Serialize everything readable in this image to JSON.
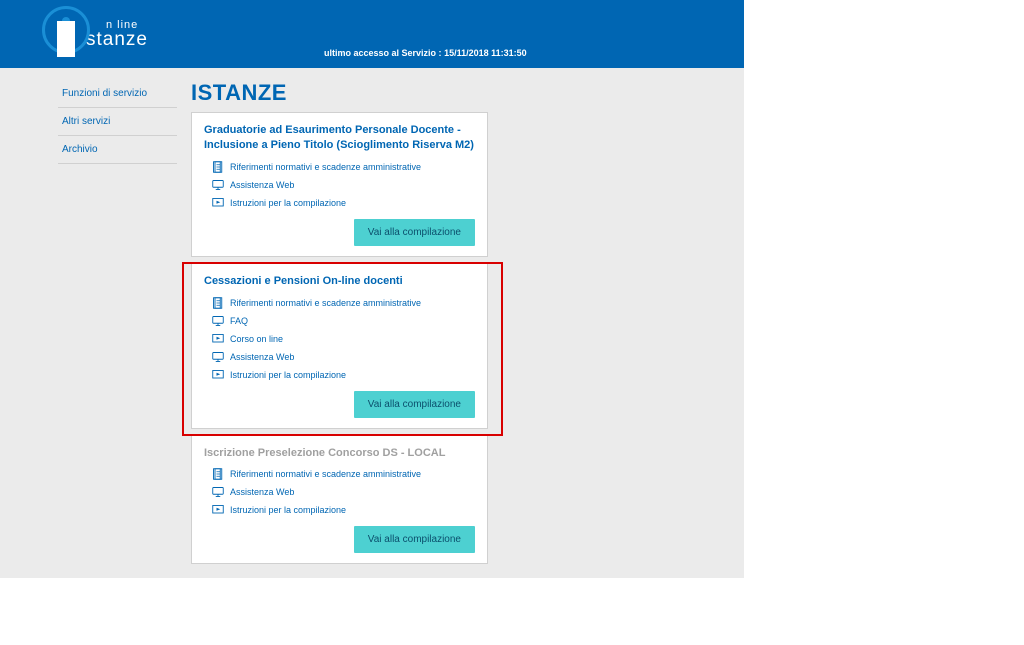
{
  "header": {
    "logo_line1": "n line",
    "logo_line2": "stanze",
    "last_access_label": "ultimo accesso al Servizio :",
    "last_access_value": "15/11/2018 11:31:50"
  },
  "sidebar": {
    "items": [
      {
        "label": "Funzioni di servizio"
      },
      {
        "label": "Altri servizi"
      },
      {
        "label": "Archivio"
      }
    ]
  },
  "main": {
    "title": "ISTANZE",
    "compile_button": "Vai alla compilazione",
    "cards": [
      {
        "title": "Graduatorie ad Esaurimento Personale Docente - Inclusione a Pieno Titolo (Scioglimento Riserva M2)",
        "highlight": false,
        "links": [
          {
            "icon": "doc",
            "label": "Riferimenti normativi e scadenze amministrative"
          },
          {
            "icon": "web",
            "label": "Assistenza Web"
          },
          {
            "icon": "play",
            "label": "Istruzioni per la compilazione"
          }
        ]
      },
      {
        "title": "Cessazioni e Pensioni On-line docenti",
        "highlight": true,
        "links": [
          {
            "icon": "doc",
            "label": "Riferimenti normativi e scadenze amministrative"
          },
          {
            "icon": "web",
            "label": "FAQ"
          },
          {
            "icon": "play",
            "label": "Corso on line"
          },
          {
            "icon": "web",
            "label": "Assistenza Web"
          },
          {
            "icon": "play",
            "label": "Istruzioni per la compilazione"
          }
        ]
      },
      {
        "title": "Iscrizione Preselezione Concorso DS - LOCAL",
        "highlight": false,
        "links": [
          {
            "icon": "doc",
            "label": "Riferimenti normativi e scadenze amministrative"
          },
          {
            "icon": "web",
            "label": "Assistenza Web"
          },
          {
            "icon": "play",
            "label": "Istruzioni per la compilazione"
          }
        ]
      }
    ]
  }
}
